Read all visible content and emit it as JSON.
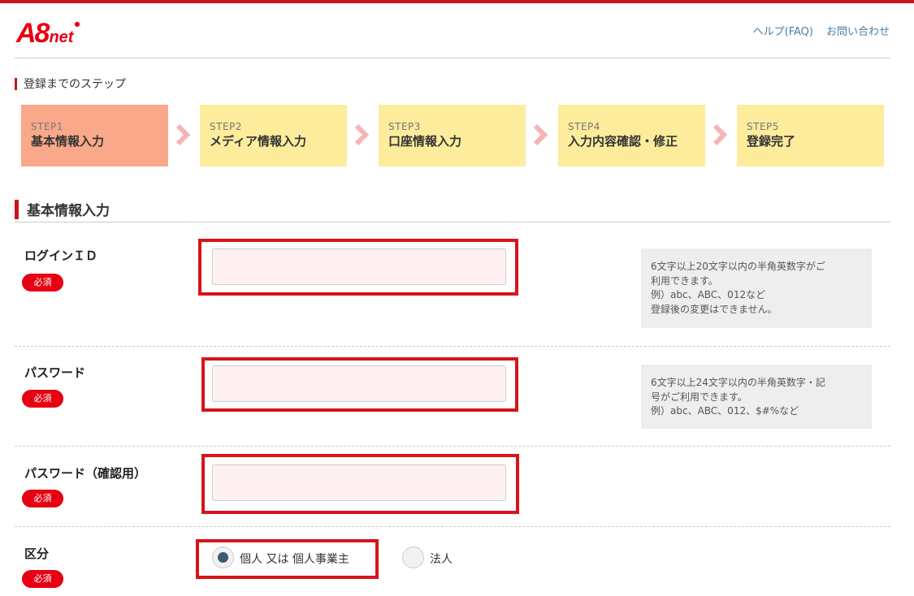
{
  "brand": {
    "logo_main": "A8",
    "logo_sub": "net",
    "logo_dot": "●",
    "color": "#e60012"
  },
  "header": {
    "links": [
      {
        "label": "ヘルプ(FAQ)"
      },
      {
        "label": "お問い合わせ"
      }
    ]
  },
  "steps_title": "登録までのステップ",
  "steps": [
    {
      "no": "STEP1",
      "label": "基本情報入力",
      "active": true
    },
    {
      "no": "STEP2",
      "label": "メディア情報入力",
      "active": false
    },
    {
      "no": "STEP3",
      "label": "口座情報入力",
      "active": false
    },
    {
      "no": "STEP4",
      "label": "入力内容確認・修正",
      "active": false
    },
    {
      "no": "STEP5",
      "label": "登録完了",
      "active": false
    }
  ],
  "section_title": "基本情報入力",
  "required_label": "必須",
  "fields": {
    "login_id": {
      "label": "ログインＩＤ",
      "value": "",
      "hint": [
        "6文字以上20文字以内の半角英数字がご",
        "利用できます。",
        "例）abc、ABC、012など",
        "登録後の変更はできません。"
      ]
    },
    "password": {
      "label": "パスワード",
      "value": "",
      "hint": [
        "6文字以上24文字以内の半角英数字・記",
        "号がご利用できます。",
        "例）abc、ABC、012、$#%など"
      ]
    },
    "password_confirm": {
      "label": "パスワード（確認用）",
      "value": ""
    },
    "category": {
      "label": "区分",
      "options": [
        {
          "label": "個人 又は 個人事業主",
          "checked": true
        },
        {
          "label": "法人",
          "checked": false
        }
      ]
    }
  },
  "colors": {
    "accent_red": "#c8161d",
    "step_active": "#f9a98a",
    "step_inactive": "#fcec9c",
    "input_bg": "#fff1f1",
    "highlight_box": "#d7141a",
    "radio_checked": "#3c5a72"
  }
}
